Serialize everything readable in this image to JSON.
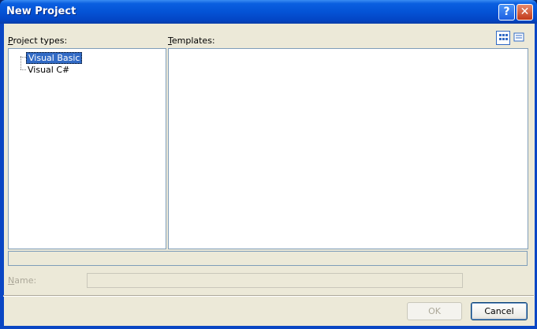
{
  "window": {
    "title": "New Project"
  },
  "titlebar": {
    "help_glyph": "?",
    "close_glyph": "✕"
  },
  "project_types": {
    "label_prefix": "P",
    "label_rest": "roject types:",
    "items": [
      {
        "label": "Visual Basic",
        "selected": true
      },
      {
        "label": "Visual C#",
        "selected": false
      }
    ]
  },
  "templates": {
    "label_prefix": "T",
    "label_rest": "emplates:"
  },
  "view_buttons": {
    "large_icons": "large-icons-view",
    "small_icons": "small-icons-view"
  },
  "name": {
    "label_prefix": "N",
    "label_rest": "ame:",
    "value": ""
  },
  "buttons": {
    "ok": "OK",
    "cancel": "Cancel"
  },
  "colors": {
    "titlebar": "#0453d6",
    "selection": "#316ac5",
    "dialog_bg": "#ece9d8"
  }
}
